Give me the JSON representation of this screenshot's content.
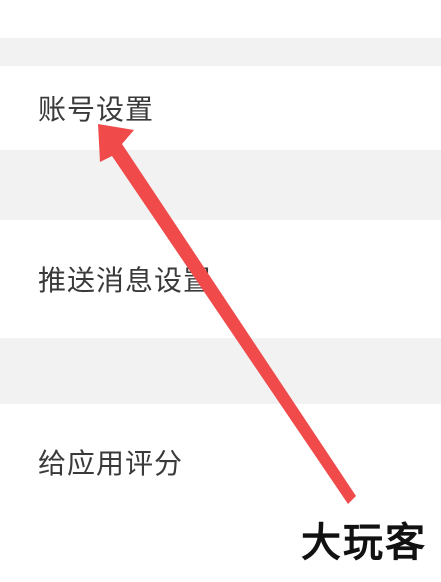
{
  "settings": {
    "items": [
      {
        "label": "账号设置"
      },
      {
        "label": "推送消息设置"
      },
      {
        "label": "给应用评分"
      }
    ]
  },
  "watermark": {
    "text": "大玩客"
  },
  "colors": {
    "row_background": "#ffffff",
    "gap_background": "#f2f2f2",
    "label_text": "#3a3a3a",
    "arrow": "#f04a4a"
  }
}
